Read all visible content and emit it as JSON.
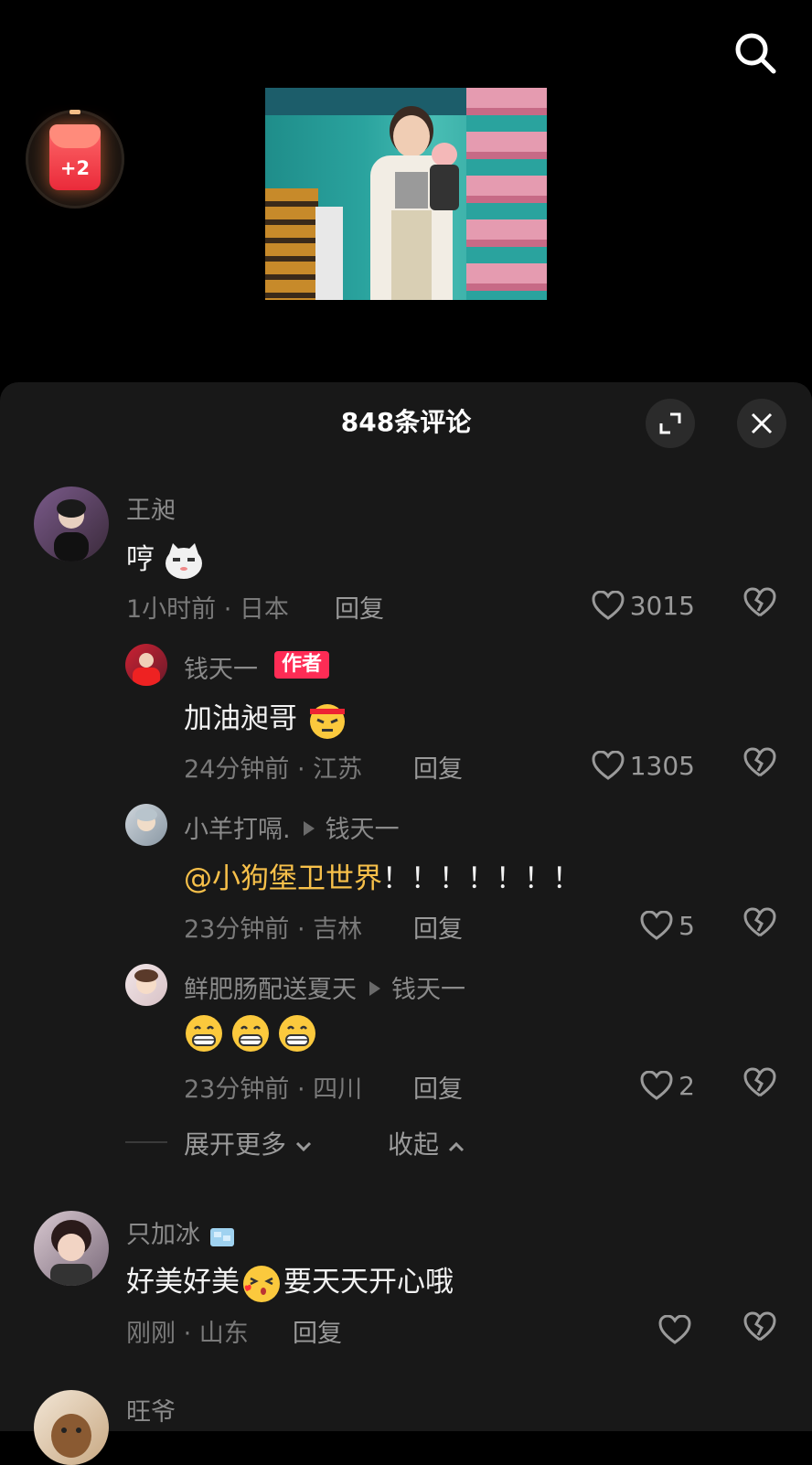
{
  "header": {
    "red_packet_label": "+2"
  },
  "sheet": {
    "title": "848条评论"
  },
  "comments": [
    {
      "user": "王昶",
      "text": "哼",
      "time_loc": "1小时前 · 日本",
      "reply": "回复",
      "likes": "3015"
    },
    {
      "user": "钱天一",
      "badge": "作者",
      "text": "加油昶哥",
      "time_loc": "24分钟前 · 江苏",
      "reply": "回复",
      "likes": "1305"
    },
    {
      "user": "小羊打嗝.",
      "to": "钱天一",
      "mention": "@小狗堡卫世界",
      "text": "！！！！！！！",
      "time_loc": "23分钟前 · 吉林",
      "reply": "回复",
      "likes": "5"
    },
    {
      "user": "鲜肥肠配送夏天",
      "to": "钱天一",
      "text": "",
      "time_loc": "23分钟前 · 四川",
      "reply": "回复",
      "likes": "2"
    },
    {
      "user": "只加冰",
      "text_a": "好美好美",
      "text_b": "要天天开心哦",
      "time_loc": "刚刚 · 山东",
      "reply": "回复",
      "likes": ""
    },
    {
      "user": "旺爷"
    }
  ],
  "thread_controls": {
    "expand": "展开更多",
    "collapse": "收起"
  },
  "colors": {
    "accent": "#fe2c55",
    "mention": "#f7c04a",
    "sheet_bg": "#181818"
  }
}
